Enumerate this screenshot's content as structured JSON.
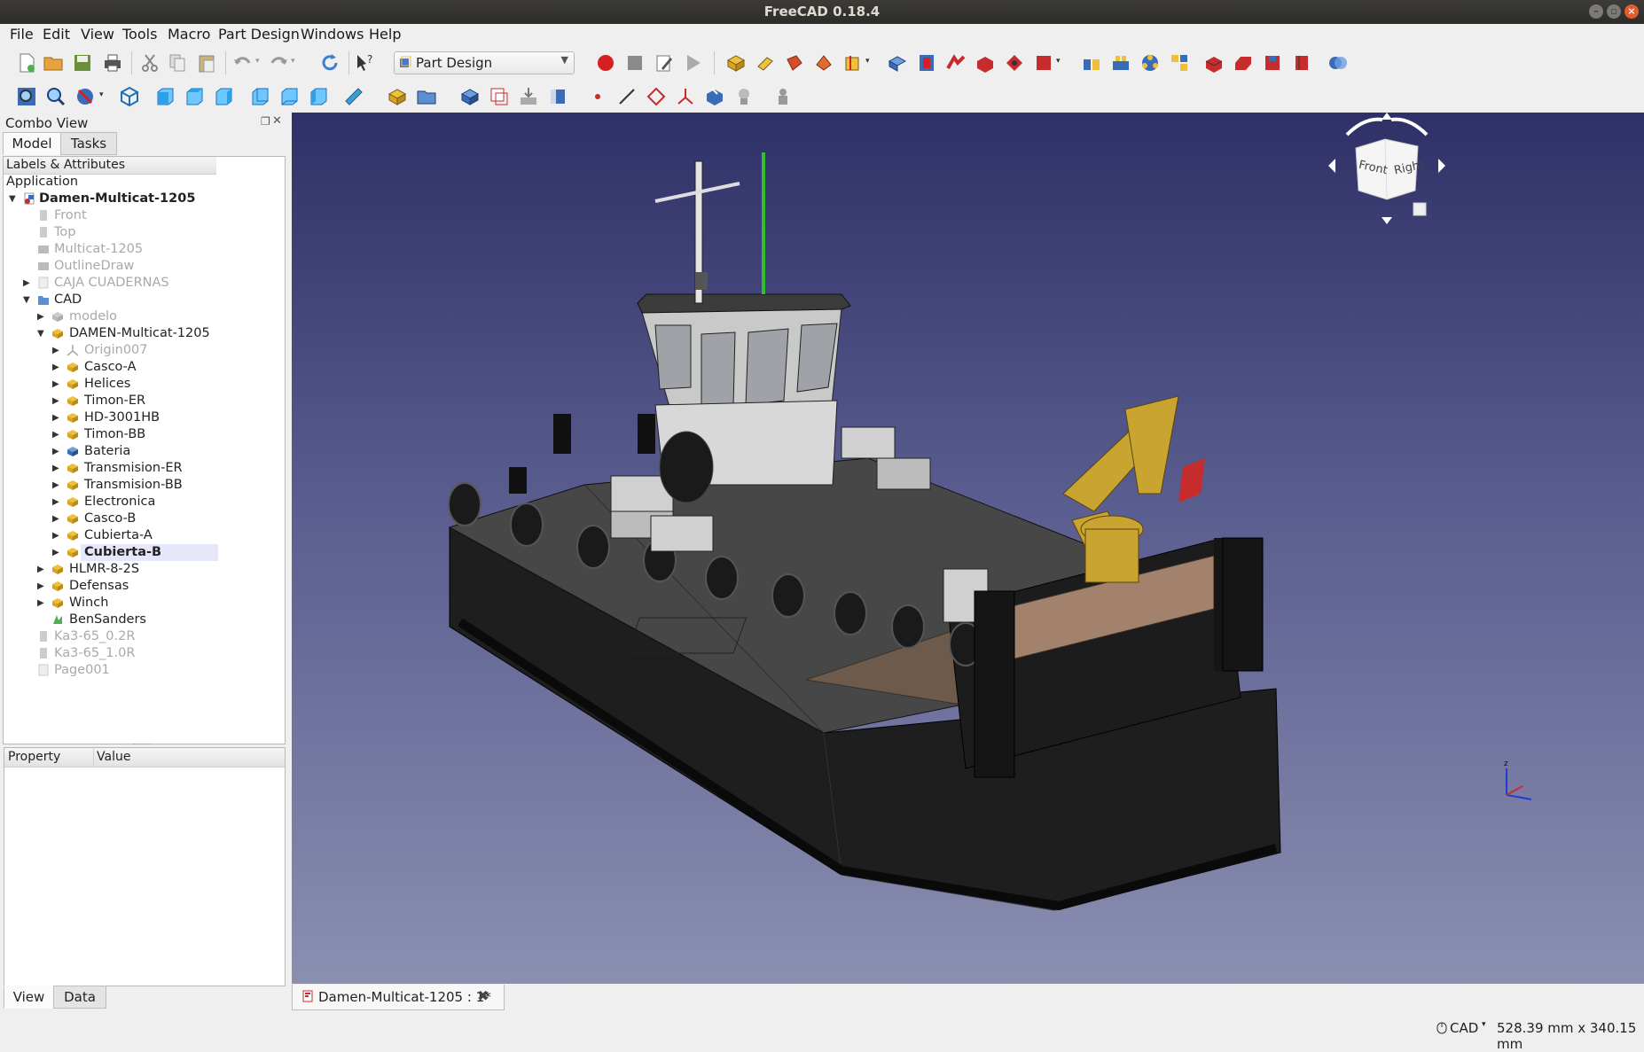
{
  "window": {
    "title": "FreeCAD 0.18.4"
  },
  "menu": [
    "File",
    "Edit",
    "View",
    "Tools",
    "Macro",
    "Part Design",
    "Windows",
    "Help"
  ],
  "workbench": {
    "selected": "Part Design"
  },
  "combo": {
    "title": "Combo View",
    "tabs": [
      "Model",
      "Tasks"
    ],
    "tree_header": "Labels & Attributes",
    "section": "Application",
    "items": [
      {
        "label": "Damen-Multicat-1205",
        "style": "bold"
      },
      {
        "label": "Front",
        "style": "dim"
      },
      {
        "label": "Top",
        "style": "dim"
      },
      {
        "label": "Multicat-1205",
        "style": "dim"
      },
      {
        "label": "OutlineDraw",
        "style": "dim"
      },
      {
        "label": "CAJA CUADERNAS",
        "style": "dim"
      },
      {
        "label": "CAD",
        "style": "normal"
      },
      {
        "label": "modelo",
        "style": "dim"
      },
      {
        "label": "DAMEN-Multicat-1205",
        "style": "normal"
      },
      {
        "label": "Origin007",
        "style": "dim"
      },
      {
        "label": "Casco-A",
        "style": "normal"
      },
      {
        "label": "Helices",
        "style": "normal"
      },
      {
        "label": "Timon-ER",
        "style": "normal"
      },
      {
        "label": "HD-3001HB",
        "style": "normal"
      },
      {
        "label": "Timon-BB",
        "style": "normal"
      },
      {
        "label": "Bateria",
        "style": "normal"
      },
      {
        "label": "Transmision-ER",
        "style": "normal"
      },
      {
        "label": "Transmision-BB",
        "style": "normal"
      },
      {
        "label": "Electronica",
        "style": "normal"
      },
      {
        "label": "Casco-B",
        "style": "normal"
      },
      {
        "label": "Cubierta-A",
        "style": "normal"
      },
      {
        "label": "Cubierta-B",
        "style": "bold"
      },
      {
        "label": "HLMR-8-2S",
        "style": "normal"
      },
      {
        "label": "Defensas",
        "style": "normal"
      },
      {
        "label": "Winch",
        "style": "normal"
      },
      {
        "label": "BenSanders",
        "style": "normal"
      },
      {
        "label": "Ka3-65_0.2R",
        "style": "dim"
      },
      {
        "label": "Ka3-65_1.0R",
        "style": "dim"
      },
      {
        "label": "Page001",
        "style": "dim"
      }
    ],
    "property_headers": [
      "Property",
      "Value"
    ],
    "bottom_tabs": [
      "View",
      "Data"
    ]
  },
  "navcube": {
    "front": "Front",
    "right": "Right"
  },
  "document_tab": "Damen-Multicat-1205 : 1*",
  "status": {
    "mode": "CAD",
    "dimensions": "528.39 mm x 340.15 mm"
  },
  "colors": {
    "viewport_top": "#2f3067",
    "viewport_bottom": "#8b8fb0",
    "selection": "#e7e7fb",
    "crane": "#c9a431"
  }
}
